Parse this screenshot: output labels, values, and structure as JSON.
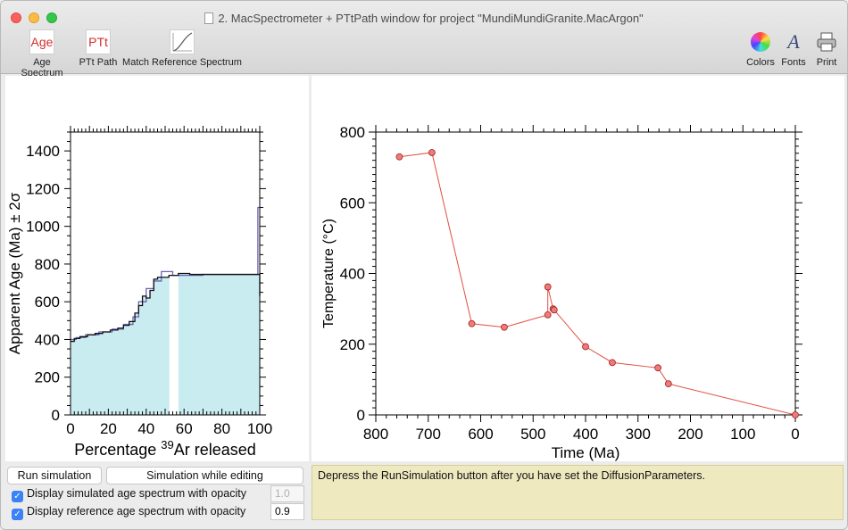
{
  "window": {
    "title": "2. MacSpectrometer + PTtPath window for project \"MundiMundiGranite.MacArgon\""
  },
  "toolbar": {
    "age_spectrum": {
      "icon_text": "Age",
      "label": "Age Spectrum"
    },
    "ptt_path": {
      "icon_text": "PTt",
      "label": "PTt Path"
    },
    "match_reference": {
      "label": "Match Reference Spectrum"
    },
    "colors": {
      "label": "Colors"
    },
    "fonts": {
      "icon_text": "A",
      "label": "Fonts"
    },
    "print": {
      "label": "Print"
    }
  },
  "colors": {
    "accent": "#d32f2f",
    "spectrum_fill": "#c9ecf0",
    "spectrum_line": "#111111",
    "reference_line": "#6b63b5",
    "path_line": "#e05040",
    "path_point": "#f07a7a",
    "message_bg": "#efe9c0"
  },
  "chart_data": [
    {
      "type": "area",
      "xlabel_prefix": "Percentage ",
      "xlabel_sup": "39",
      "xlabel_suffix": "Ar released",
      "ylabel": "Apparent Age (Ma) ± 2σ",
      "xlim": [
        0,
        100
      ],
      "ylim": [
        0,
        1500
      ],
      "xticks": [
        "0",
        "20",
        "40",
        "60",
        "80",
        "100"
      ],
      "yticks": [
        "0",
        "200",
        "400",
        "600",
        "800",
        "1000",
        "1200",
        "1400"
      ],
      "steps": [
        {
          "x0": 0,
          "x1": 2,
          "age": 390
        },
        {
          "x0": 2,
          "x1": 5,
          "age": 405
        },
        {
          "x0": 5,
          "x1": 9,
          "age": 415
        },
        {
          "x0": 9,
          "x1": 13,
          "age": 425
        },
        {
          "x0": 13,
          "x1": 17,
          "age": 432
        },
        {
          "x0": 17,
          "x1": 21,
          "age": 440
        },
        {
          "x0": 21,
          "x1": 25,
          "age": 450
        },
        {
          "x0": 25,
          "x1": 28,
          "age": 460
        },
        {
          "x0": 28,
          "x1": 31,
          "age": 475
        },
        {
          "x0": 31,
          "x1": 34,
          "age": 495
        },
        {
          "x0": 34,
          "x1": 36,
          "age": 540
        },
        {
          "x0": 36,
          "x1": 38,
          "age": 580
        },
        {
          "x0": 38,
          "x1": 40,
          "age": 630
        },
        {
          "x0": 40,
          "x1": 42,
          "age": 620
        },
        {
          "x0": 42,
          "x1": 44,
          "age": 660
        },
        {
          "x0": 44,
          "x1": 46,
          "age": 720
        },
        {
          "x0": 46,
          "x1": 52,
          "age": 730
        },
        {
          "x0": 52,
          "x1": 57,
          "age": 740
        },
        {
          "x0": 57,
          "x1": 63,
          "age": 750
        },
        {
          "x0": 63,
          "x1": 70,
          "age": 745
        },
        {
          "x0": 70,
          "x1": 80,
          "age": 745
        },
        {
          "x0": 80,
          "x1": 90,
          "age": 745
        },
        {
          "x0": 90,
          "x1": 100,
          "age": 745
        }
      ],
      "fill_gaps": [
        [
          52,
          57
        ],
        [
          63,
          65
        ],
        [
          91,
          100
        ]
      ],
      "reference_steps": [
        {
          "x0": 0,
          "x1": 3,
          "age": 400
        },
        {
          "x0": 3,
          "x1": 8,
          "age": 410
        },
        {
          "x0": 8,
          "x1": 15,
          "age": 425
        },
        {
          "x0": 15,
          "x1": 22,
          "age": 440
        },
        {
          "x0": 22,
          "x1": 28,
          "age": 455
        },
        {
          "x0": 28,
          "x1": 33,
          "age": 480
        },
        {
          "x0": 33,
          "x1": 36,
          "age": 520
        },
        {
          "x0": 36,
          "x1": 40,
          "age": 600
        },
        {
          "x0": 40,
          "x1": 44,
          "age": 670
        },
        {
          "x0": 44,
          "x1": 48,
          "age": 710
        },
        {
          "x0": 48,
          "x1": 54,
          "age": 760
        },
        {
          "x0": 54,
          "x1": 60,
          "age": 740
        },
        {
          "x0": 60,
          "x1": 70,
          "age": 740
        },
        {
          "x0": 70,
          "x1": 99,
          "age": 745
        },
        {
          "x0": 99,
          "x1": 100,
          "age": 1100
        }
      ]
    },
    {
      "type": "line",
      "xlabel": "Time (Ma)",
      "ylabel": "Temperature (°C)",
      "xlim": [
        800,
        0
      ],
      "ylim": [
        0,
        800
      ],
      "xticks": [
        "800",
        "700",
        "600",
        "500",
        "400",
        "300",
        "200",
        "100",
        "0"
      ],
      "yticks": [
        "0",
        "200",
        "400",
        "600",
        "800"
      ],
      "points": [
        {
          "x": 755,
          "y": 730
        },
        {
          "x": 693,
          "y": 742
        },
        {
          "x": 617,
          "y": 258
        },
        {
          "x": 555,
          "y": 248
        },
        {
          "x": 472,
          "y": 283
        },
        {
          "x": 472,
          "y": 362
        },
        {
          "x": 462,
          "y": 300
        },
        {
          "x": 460,
          "y": 297
        },
        {
          "x": 400,
          "y": 193
        },
        {
          "x": 349,
          "y": 148
        },
        {
          "x": 262,
          "y": 133
        },
        {
          "x": 242,
          "y": 88
        },
        {
          "x": 0,
          "y": 0
        }
      ]
    }
  ],
  "controls": {
    "run_simulation": "Run simulation",
    "simulation_while_editing": "Simulation while editing",
    "display_simulated": "Display simulated age spectrum with opacity",
    "simulated_opacity": "1.0",
    "display_reference": "Display reference age spectrum with opacity",
    "reference_opacity": "0.9"
  },
  "message": "Depress the RunSimulation button after you have set the DiffusionParameters."
}
